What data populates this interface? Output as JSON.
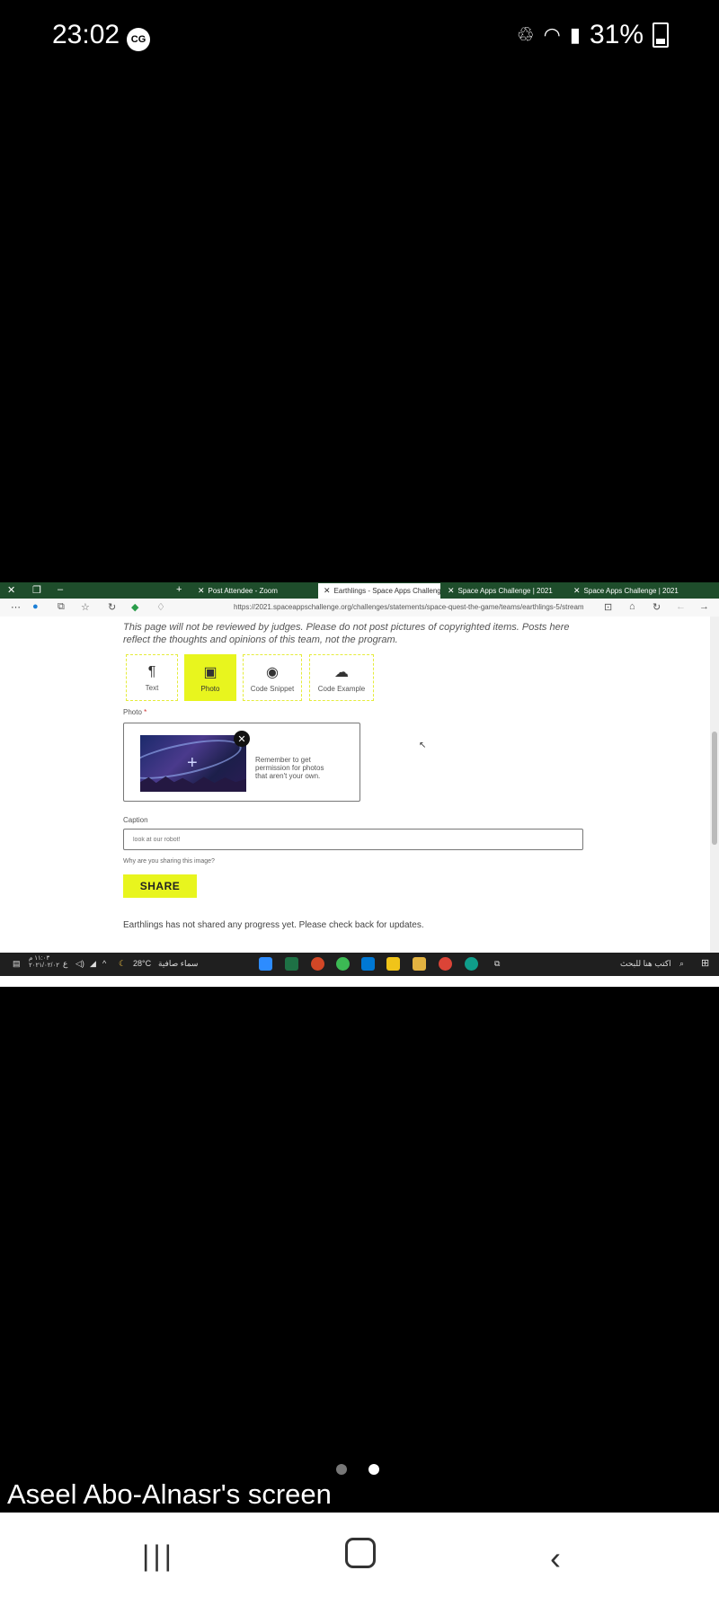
{
  "phone_status": {
    "time": "23:02",
    "badge": "CG",
    "battery": "31%"
  },
  "browser": {
    "tabs": [
      {
        "title": "Post Attendee - Zoom",
        "active": false
      },
      {
        "title": "Earthlings - Space Apps Challenge",
        "active": true
      },
      {
        "title": "Space Apps Challenge | 2021",
        "active": false
      },
      {
        "title": "Space Apps Challenge | 2021",
        "active": false
      }
    ],
    "url": "https://2021.spaceappschallenge.org/challenges/statements/space-quest-the-game/teams/earthlings-5/stream"
  },
  "page": {
    "notice": "This page will not be reviewed by judges. Please do not post pictures of copyrighted items. Posts here reflect the thoughts and opinions of this team, not the program.",
    "post_types": [
      {
        "label": "Text",
        "icon": "paragraph-icon",
        "glyph": "¶",
        "active": false
      },
      {
        "label": "Photo",
        "icon": "image-icon",
        "glyph": "🖼",
        "active": true
      },
      {
        "label": "Code Snippet",
        "icon": "github-icon",
        "glyph": "◉",
        "active": false
      },
      {
        "label": "Code Example",
        "icon": "codepen-icon",
        "glyph": "☁",
        "active": false
      }
    ],
    "photo_label": "Photo",
    "photo_hint": "Remember to get permission for photos that aren't your own.",
    "caption_label": "Caption",
    "caption_placeholder": "look at our robot!",
    "caption_help": "Why are you sharing this image?",
    "share_label": "SHARE",
    "no_progress": "Earthlings has not shared any progress yet. Please check back for updates."
  },
  "taskbar": {
    "time": "١١:٠٣ م",
    "date": "٢٠٢١/٠٢/٠٢",
    "lang": "ع",
    "weather": "28°C",
    "weather_text": "سماء صافية",
    "search": "اكتب هنا للبحث"
  },
  "screen_share_label": "Aseel Abo-Alnasr's screen"
}
